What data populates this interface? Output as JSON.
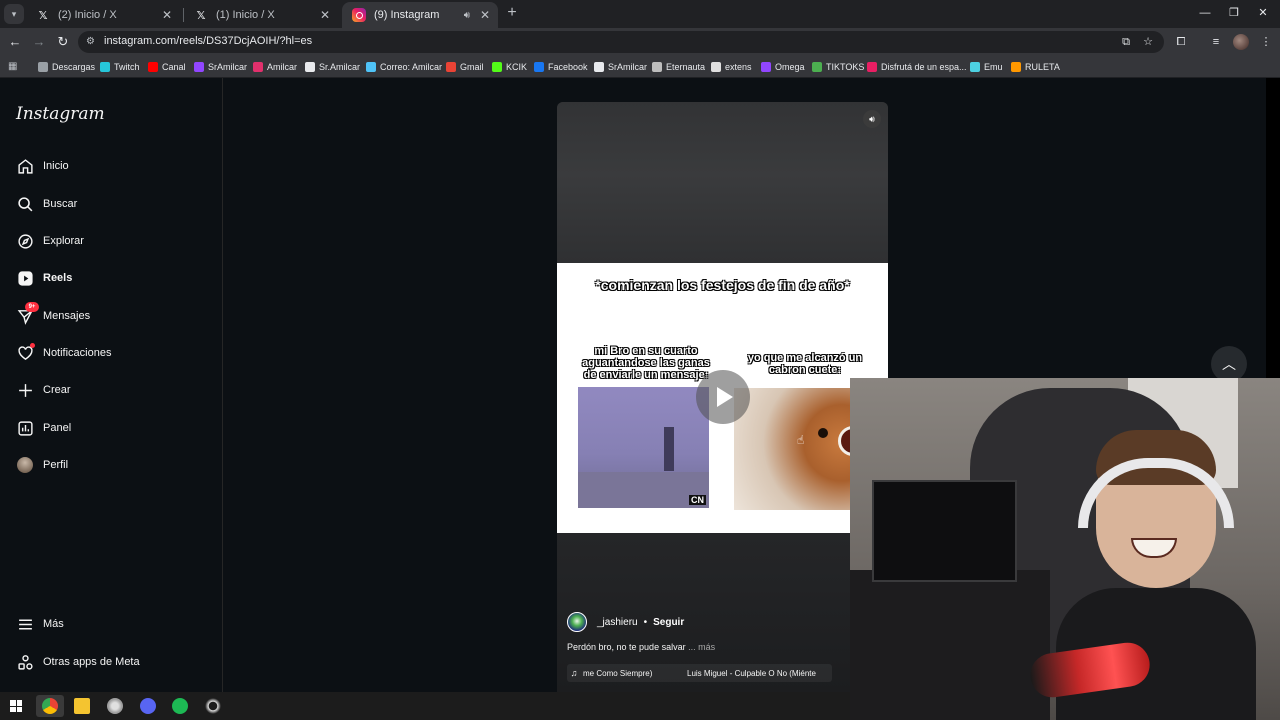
{
  "browser": {
    "tabs": [
      {
        "title": "(2) Inicio / X",
        "icon": "x-logo-icon",
        "active": false
      },
      {
        "title": "(1) Inicio / X",
        "icon": "x-logo-icon",
        "active": false
      },
      {
        "title": "(9) Instagram",
        "icon": "instagram-icon",
        "active": true
      }
    ],
    "url": "instagram.com/reels/DS37DcjAOIH/?hl=es",
    "bookmarks": [
      {
        "label": "Descargas",
        "color": "#9aa0a6"
      },
      {
        "label": "Twitch",
        "color": "#26c6da"
      },
      {
        "label": "Canal",
        "color": "#ff0000"
      },
      {
        "label": "SrAmilcar",
        "color": "#9146ff"
      },
      {
        "label": "Amilcar",
        "color": "#e1306c"
      },
      {
        "label": "Sr.Amilcar",
        "color": "#e8eaed"
      },
      {
        "label": "Correo: Amilcar",
        "color": "#4fc3f7"
      },
      {
        "label": "Gmail",
        "color": "#ea4335"
      },
      {
        "label": "KCIK",
        "color": "#53fc18"
      },
      {
        "label": "Facebook",
        "color": "#1877f2"
      },
      {
        "label": "SrAmilcar",
        "color": "#e8eaed"
      },
      {
        "label": "Eternauta",
        "color": "#bdbdbd"
      },
      {
        "label": "extens",
        "color": "#e0e0e0"
      },
      {
        "label": "Omega",
        "color": "#9146ff"
      },
      {
        "label": "TIKTOKS",
        "color": "#4caf50"
      },
      {
        "label": "Disfrutá de un espa...",
        "color": "#e91e63"
      },
      {
        "label": "Emu",
        "color": "#4dd0e1"
      },
      {
        "label": "RULETA",
        "color": "#ff9800"
      }
    ]
  },
  "instagram": {
    "logo": "Instagram",
    "nav": [
      {
        "label": "Inicio",
        "icon": "home-icon"
      },
      {
        "label": "Buscar",
        "icon": "search-icon"
      },
      {
        "label": "Explorar",
        "icon": "compass-icon"
      },
      {
        "label": "Reels",
        "icon": "reels-icon",
        "active": true
      },
      {
        "label": "Mensajes",
        "icon": "messenger-icon",
        "badge": "9+"
      },
      {
        "label": "Notificaciones",
        "icon": "heart-icon"
      },
      {
        "label": "Crear",
        "icon": "plus-icon"
      },
      {
        "label": "Panel",
        "icon": "chart-icon"
      },
      {
        "label": "Perfil",
        "icon": "avatar"
      }
    ],
    "bottom_nav": [
      {
        "label": "Más",
        "icon": "menu-icon"
      },
      {
        "label": "Otras apps de Meta",
        "icon": "meta-apps-icon"
      }
    ],
    "reel": {
      "meme_title": "*comienzan los festejos de fin de año*",
      "caption_left": "mi Bro en su cuarto aguantandose las ganas de enviarle un mensaje:",
      "caption_right": "yo que me alcanzó un cabron cuete:",
      "watermark": "CN",
      "username": "_jashieru",
      "separator": "•",
      "follow": "Seguir",
      "caption": "Perdón bro, no te pude salvar",
      "more": "... más",
      "audio_1": "me Como Siempre)",
      "audio_2": "Luis Miguel - Culpable O No (Miénte"
    }
  },
  "taskbar": {
    "apps": [
      "windows-start-icon",
      "chrome-icon",
      "file-explorer-icon",
      "steam-icon",
      "discord-icon",
      "spotify-icon",
      "obs-icon"
    ]
  }
}
